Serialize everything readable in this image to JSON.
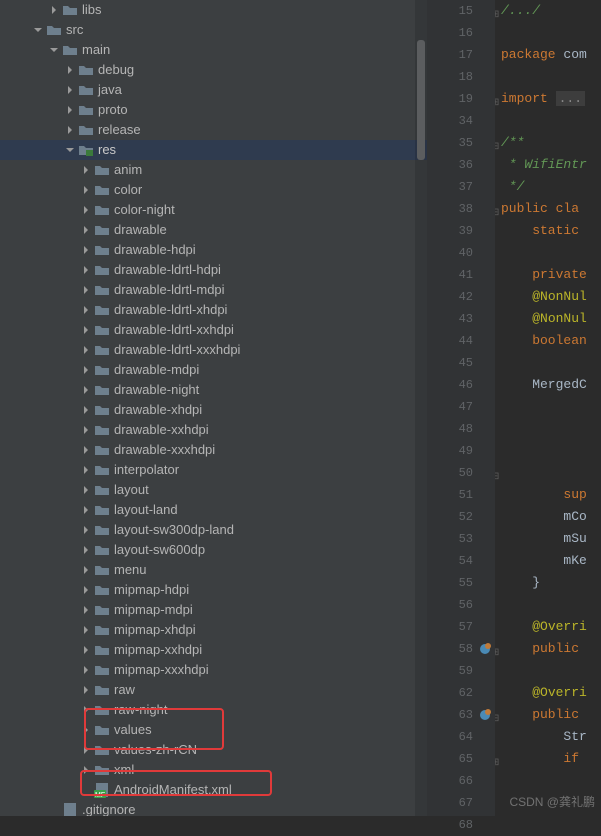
{
  "tree": [
    {
      "indent": 48,
      "chev": "right",
      "icon": "folder",
      "label": "libs"
    },
    {
      "indent": 32,
      "chev": "down",
      "icon": "folder",
      "label": "src"
    },
    {
      "indent": 48,
      "chev": "down",
      "icon": "folder",
      "label": "main"
    },
    {
      "indent": 64,
      "chev": "right",
      "icon": "folder",
      "label": "debug"
    },
    {
      "indent": 64,
      "chev": "right",
      "icon": "folder",
      "label": "java"
    },
    {
      "indent": 64,
      "chev": "right",
      "icon": "folder",
      "label": "proto"
    },
    {
      "indent": 64,
      "chev": "right",
      "icon": "folder",
      "label": "release"
    },
    {
      "indent": 64,
      "chev": "down",
      "icon": "resfolder",
      "label": "res",
      "selected": true
    },
    {
      "indent": 80,
      "chev": "right",
      "icon": "folder",
      "label": "anim"
    },
    {
      "indent": 80,
      "chev": "right",
      "icon": "folder",
      "label": "color"
    },
    {
      "indent": 80,
      "chev": "right",
      "icon": "folder",
      "label": "color-night"
    },
    {
      "indent": 80,
      "chev": "right",
      "icon": "folder",
      "label": "drawable"
    },
    {
      "indent": 80,
      "chev": "right",
      "icon": "folder",
      "label": "drawable-hdpi"
    },
    {
      "indent": 80,
      "chev": "right",
      "icon": "folder",
      "label": "drawable-ldrtl-hdpi"
    },
    {
      "indent": 80,
      "chev": "right",
      "icon": "folder",
      "label": "drawable-ldrtl-mdpi"
    },
    {
      "indent": 80,
      "chev": "right",
      "icon": "folder",
      "label": "drawable-ldrtl-xhdpi"
    },
    {
      "indent": 80,
      "chev": "right",
      "icon": "folder",
      "label": "drawable-ldrtl-xxhdpi"
    },
    {
      "indent": 80,
      "chev": "right",
      "icon": "folder",
      "label": "drawable-ldrtl-xxxhdpi"
    },
    {
      "indent": 80,
      "chev": "right",
      "icon": "folder",
      "label": "drawable-mdpi"
    },
    {
      "indent": 80,
      "chev": "right",
      "icon": "folder",
      "label": "drawable-night"
    },
    {
      "indent": 80,
      "chev": "right",
      "icon": "folder",
      "label": "drawable-xhdpi"
    },
    {
      "indent": 80,
      "chev": "right",
      "icon": "folder",
      "label": "drawable-xxhdpi"
    },
    {
      "indent": 80,
      "chev": "right",
      "icon": "folder",
      "label": "drawable-xxxhdpi"
    },
    {
      "indent": 80,
      "chev": "right",
      "icon": "folder",
      "label": "interpolator"
    },
    {
      "indent": 80,
      "chev": "right",
      "icon": "folder",
      "label": "layout"
    },
    {
      "indent": 80,
      "chev": "right",
      "icon": "folder",
      "label": "layout-land"
    },
    {
      "indent": 80,
      "chev": "right",
      "icon": "folder",
      "label": "layout-sw300dp-land"
    },
    {
      "indent": 80,
      "chev": "right",
      "icon": "folder",
      "label": "layout-sw600dp"
    },
    {
      "indent": 80,
      "chev": "right",
      "icon": "folder",
      "label": "menu"
    },
    {
      "indent": 80,
      "chev": "right",
      "icon": "folder",
      "label": "mipmap-hdpi"
    },
    {
      "indent": 80,
      "chev": "right",
      "icon": "folder",
      "label": "mipmap-mdpi"
    },
    {
      "indent": 80,
      "chev": "right",
      "icon": "folder",
      "label": "mipmap-xhdpi"
    },
    {
      "indent": 80,
      "chev": "right",
      "icon": "folder",
      "label": "mipmap-xxhdpi"
    },
    {
      "indent": 80,
      "chev": "right",
      "icon": "folder",
      "label": "mipmap-xxxhdpi"
    },
    {
      "indent": 80,
      "chev": "right",
      "icon": "folder",
      "label": "raw"
    },
    {
      "indent": 80,
      "chev": "right",
      "icon": "folder",
      "label": "raw-night"
    },
    {
      "indent": 80,
      "chev": "right",
      "icon": "folder",
      "label": "values"
    },
    {
      "indent": 80,
      "chev": "right",
      "icon": "folder",
      "label": "values-zh-rCN"
    },
    {
      "indent": 80,
      "chev": "right",
      "icon": "folder",
      "label": "xml"
    },
    {
      "indent": 80,
      "chev": "none",
      "icon": "manifest",
      "label": "AndroidManifest.xml"
    },
    {
      "indent": 48,
      "chev": "none",
      "icon": "gitignore",
      "label": ".gitignore"
    }
  ],
  "gutter": {
    "lines": [
      15,
      16,
      17,
      18,
      19,
      34,
      35,
      36,
      37,
      38,
      39,
      40,
      41,
      42,
      43,
      44,
      45,
      46,
      47,
      48,
      49,
      50,
      51,
      52,
      53,
      54,
      55,
      56,
      57,
      58,
      59,
      62,
      63,
      64,
      65,
      66,
      67,
      68
    ],
    "override_marks": [
      58,
      63
    ]
  },
  "code": {
    "15": {
      "tokens": [
        {
          "t": "/.../",
          "c": "com"
        }
      ],
      "fold": "plus"
    },
    "16": {
      "tokens": []
    },
    "17": {
      "tokens": [
        {
          "t": "package ",
          "c": "kw"
        },
        {
          "t": "com",
          "c": ""
        }
      ]
    },
    "18": {
      "tokens": []
    },
    "19": {
      "tokens": [
        {
          "t": "import ",
          "c": "kw"
        },
        {
          "t": "...",
          "c": "fold"
        }
      ],
      "fold": "plus"
    },
    "34": {
      "tokens": []
    },
    "35": {
      "tokens": [
        {
          "t": "/**",
          "c": "com"
        }
      ],
      "fold": "minus"
    },
    "36": {
      "tokens": [
        {
          "t": " * WifiEntr",
          "c": "com"
        }
      ]
    },
    "37": {
      "tokens": [
        {
          "t": " */",
          "c": "com"
        }
      ]
    },
    "38": {
      "tokens": [
        {
          "t": "public cla",
          "c": "kw"
        }
      ],
      "fold": "minus"
    },
    "39": {
      "tokens": [
        {
          "t": "    static ",
          "c": "kw"
        }
      ]
    },
    "40": {
      "tokens": []
    },
    "41": {
      "tokens": [
        {
          "t": "    private",
          "c": "kw"
        }
      ]
    },
    "42": {
      "tokens": [
        {
          "t": "    ",
          "c": ""
        },
        {
          "t": "@NonNul",
          "c": "ann"
        }
      ]
    },
    "43": {
      "tokens": [
        {
          "t": "    ",
          "c": ""
        },
        {
          "t": "@NonNul",
          "c": "ann"
        }
      ]
    },
    "44": {
      "tokens": [
        {
          "t": "    boolean",
          "c": "kw"
        }
      ]
    },
    "45": {
      "tokens": []
    },
    "46": {
      "tokens": [
        {
          "t": "    MergedC",
          "c": ""
        }
      ]
    },
    "47": {
      "tokens": []
    },
    "48": {
      "tokens": []
    },
    "49": {
      "tokens": []
    },
    "50": {
      "tokens": [],
      "fold": "minus"
    },
    "51": {
      "tokens": [
        {
          "t": "        sup",
          "c": "kw"
        }
      ]
    },
    "52": {
      "tokens": [
        {
          "t": "        mCo",
          "c": ""
        }
      ]
    },
    "53": {
      "tokens": [
        {
          "t": "        mSu",
          "c": ""
        }
      ]
    },
    "54": {
      "tokens": [
        {
          "t": "        mKe",
          "c": ""
        }
      ]
    },
    "55": {
      "tokens": [
        {
          "t": "    }",
          "c": ""
        }
      ]
    },
    "56": {
      "tokens": []
    },
    "57": {
      "tokens": [
        {
          "t": "    ",
          "c": ""
        },
        {
          "t": "@Overri",
          "c": "ann"
        }
      ]
    },
    "58": {
      "tokens": [
        {
          "t": "    public ",
          "c": "kw"
        }
      ],
      "fold": "plus"
    },
    "59": {
      "tokens": []
    },
    "62": {
      "tokens": [
        {
          "t": "    ",
          "c": ""
        },
        {
          "t": "@Overri",
          "c": "ann"
        }
      ]
    },
    "63": {
      "tokens": [
        {
          "t": "    public ",
          "c": "kw"
        }
      ],
      "fold": "minus"
    },
    "64": {
      "tokens": [
        {
          "t": "        Str",
          "c": ""
        }
      ]
    },
    "65": {
      "tokens": [
        {
          "t": "        if ",
          "c": "kw"
        }
      ],
      "fold": "plus"
    },
    "66": {
      "tokens": []
    },
    "67": {
      "tokens": []
    },
    "68": {
      "tokens": []
    }
  },
  "watermark": "CSDN @龚礼鹏"
}
